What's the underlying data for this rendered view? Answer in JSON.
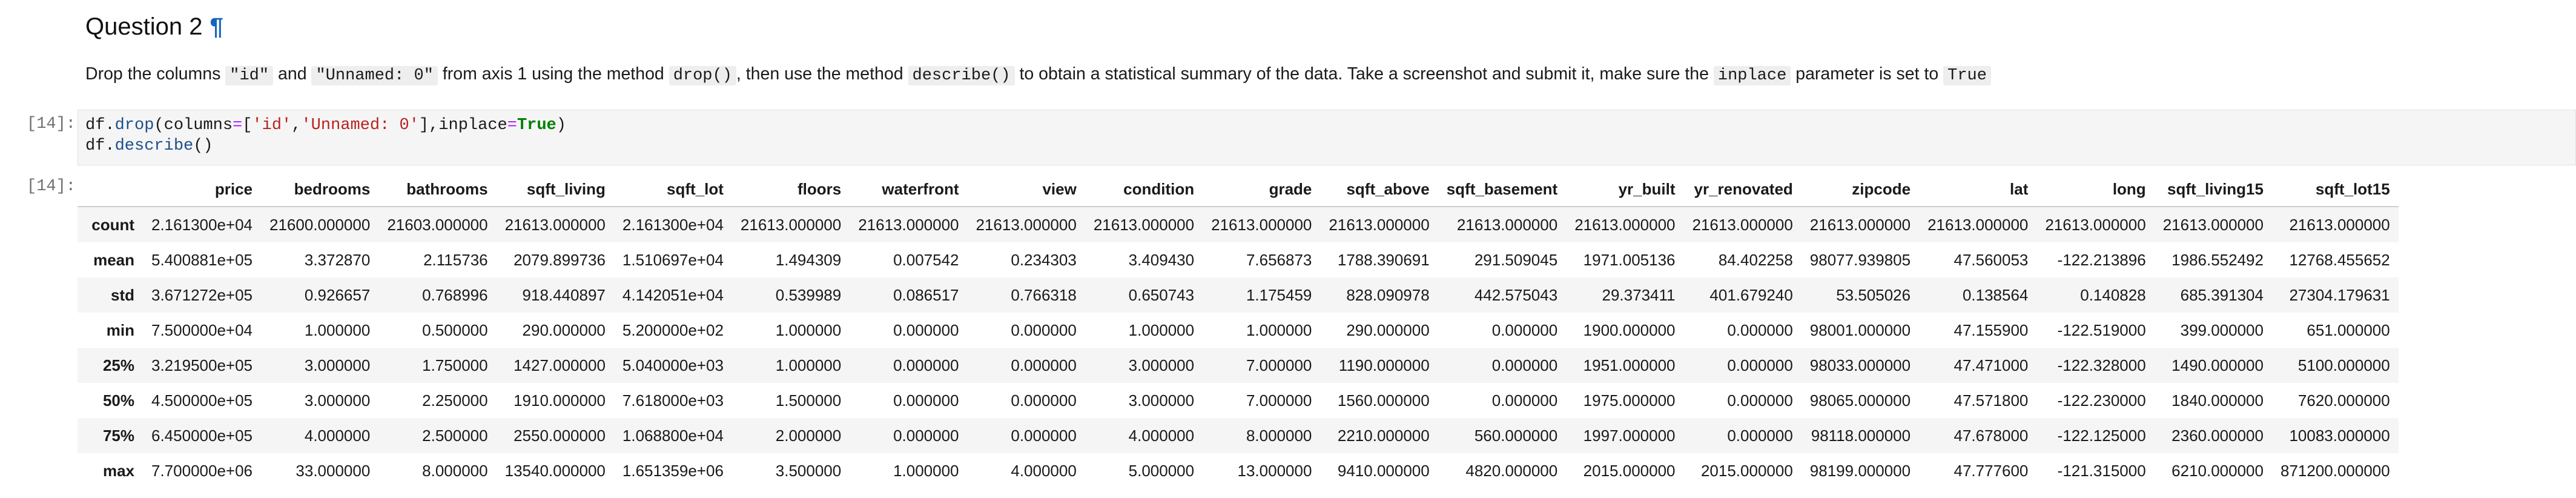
{
  "heading": {
    "title": "Question 2",
    "anchor": "¶"
  },
  "instruction": {
    "t1": "Drop the columns ",
    "c1": "\"id\"",
    "t2": " and ",
    "c2": "\"Unnamed: 0\"",
    "t3": " from axis 1 using the method ",
    "c3": "drop()",
    "t4": ", then use the method ",
    "c4": "describe()",
    "t5": " to obtain a statistical summary of the data. Take a screenshot and submit it, make sure the ",
    "c5": "inplace",
    "t6": " parameter is set to ",
    "c6": "True"
  },
  "input_cell": {
    "prompt": "[14]:",
    "line1": {
      "obj": "df",
      "dot": ".",
      "method": "drop",
      "open": "(",
      "kwarg": "columns",
      "eq": "=",
      "lbr": "[",
      "s1": "'id'",
      "comma": ",",
      "s2": "'Unnamed: 0'",
      "rbr": "]",
      "comma2": ",",
      "kwarg2": "inplace",
      "eq2": "=",
      "kwval": "True",
      "close": ")"
    },
    "line2": {
      "obj": "df",
      "dot": ".",
      "method": "describe",
      "parens": "()"
    }
  },
  "output_cell": {
    "prompt": "[14]:"
  },
  "table": {
    "columns": [
      "price",
      "bedrooms",
      "bathrooms",
      "sqft_living",
      "sqft_lot",
      "floors",
      "waterfront",
      "view",
      "condition",
      "grade",
      "sqft_above",
      "sqft_basement",
      "yr_built",
      "yr_renovated",
      "zipcode",
      "lat",
      "long",
      "sqft_living15",
      "sqft_lot15"
    ],
    "rows": [
      {
        "label": "count",
        "values": [
          "2.161300e+04",
          "21600.000000",
          "21603.000000",
          "21613.000000",
          "2.161300e+04",
          "21613.000000",
          "21613.000000",
          "21613.000000",
          "21613.000000",
          "21613.000000",
          "21613.000000",
          "21613.000000",
          "21613.000000",
          "21613.000000",
          "21613.000000",
          "21613.000000",
          "21613.000000",
          "21613.000000",
          "21613.000000"
        ]
      },
      {
        "label": "mean",
        "values": [
          "5.400881e+05",
          "3.372870",
          "2.115736",
          "2079.899736",
          "1.510697e+04",
          "1.494309",
          "0.007542",
          "0.234303",
          "3.409430",
          "7.656873",
          "1788.390691",
          "291.509045",
          "1971.005136",
          "84.402258",
          "98077.939805",
          "47.560053",
          "-122.213896",
          "1986.552492",
          "12768.455652"
        ]
      },
      {
        "label": "std",
        "values": [
          "3.671272e+05",
          "0.926657",
          "0.768996",
          "918.440897",
          "4.142051e+04",
          "0.539989",
          "0.086517",
          "0.766318",
          "0.650743",
          "1.175459",
          "828.090978",
          "442.575043",
          "29.373411",
          "401.679240",
          "53.505026",
          "0.138564",
          "0.140828",
          "685.391304",
          "27304.179631"
        ]
      },
      {
        "label": "min",
        "values": [
          "7.500000e+04",
          "1.000000",
          "0.500000",
          "290.000000",
          "5.200000e+02",
          "1.000000",
          "0.000000",
          "0.000000",
          "1.000000",
          "1.000000",
          "290.000000",
          "0.000000",
          "1900.000000",
          "0.000000",
          "98001.000000",
          "47.155900",
          "-122.519000",
          "399.000000",
          "651.000000"
        ]
      },
      {
        "label": "25%",
        "values": [
          "3.219500e+05",
          "3.000000",
          "1.750000",
          "1427.000000",
          "5.040000e+03",
          "1.000000",
          "0.000000",
          "0.000000",
          "3.000000",
          "7.000000",
          "1190.000000",
          "0.000000",
          "1951.000000",
          "0.000000",
          "98033.000000",
          "47.471000",
          "-122.328000",
          "1490.000000",
          "5100.000000"
        ]
      },
      {
        "label": "50%",
        "values": [
          "4.500000e+05",
          "3.000000",
          "2.250000",
          "1910.000000",
          "7.618000e+03",
          "1.500000",
          "0.000000",
          "0.000000",
          "3.000000",
          "7.000000",
          "1560.000000",
          "0.000000",
          "1975.000000",
          "0.000000",
          "98065.000000",
          "47.571800",
          "-122.230000",
          "1840.000000",
          "7620.000000"
        ]
      },
      {
        "label": "75%",
        "values": [
          "6.450000e+05",
          "4.000000",
          "2.500000",
          "2550.000000",
          "1.068800e+04",
          "2.000000",
          "0.000000",
          "0.000000",
          "4.000000",
          "8.000000",
          "2210.000000",
          "560.000000",
          "1997.000000",
          "0.000000",
          "98118.000000",
          "47.678000",
          "-122.125000",
          "2360.000000",
          "10083.000000"
        ]
      },
      {
        "label": "max",
        "values": [
          "7.700000e+06",
          "33.000000",
          "8.000000",
          "13540.000000",
          "1.651359e+06",
          "3.500000",
          "1.000000",
          "4.000000",
          "5.000000",
          "13.000000",
          "9410.000000",
          "4820.000000",
          "2015.000000",
          "2015.000000",
          "98199.000000",
          "47.777600",
          "-121.315000",
          "6210.000000",
          "871200.000000"
        ]
      }
    ]
  }
}
